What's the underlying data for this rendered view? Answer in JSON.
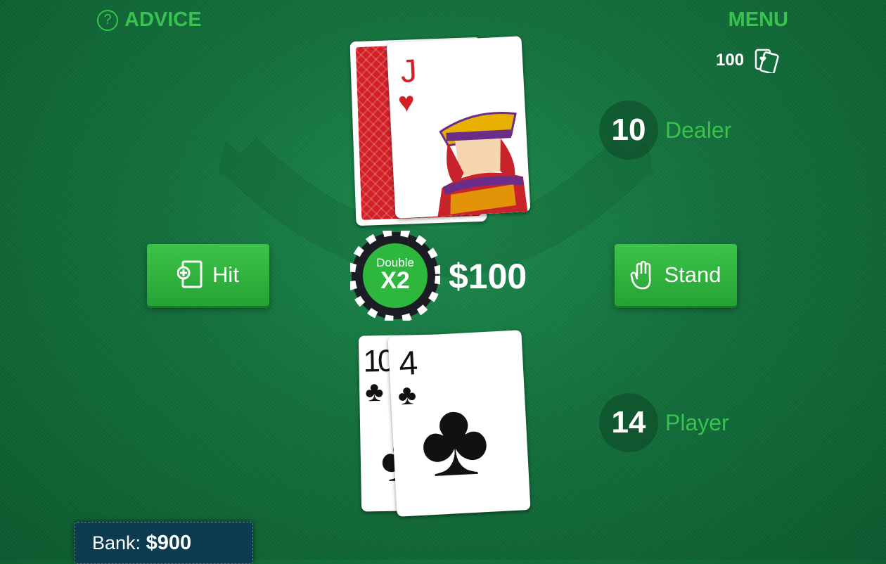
{
  "header": {
    "advice_label": "ADVICE",
    "advice_icon": "?",
    "menu_label": "MENU",
    "deck_count": "100"
  },
  "dealer": {
    "score": "10",
    "label": "Dealer",
    "cards": [
      {
        "rank": "J",
        "suit": "♥",
        "face_down": false
      },
      {
        "face_down": true
      }
    ]
  },
  "player": {
    "score": "14",
    "label": "Player",
    "cards": [
      {
        "rank": "10",
        "suit": "♣"
      },
      {
        "rank": "4",
        "suit": "♣"
      }
    ]
  },
  "actions": {
    "hit_label": "Hit",
    "stand_label": "Stand"
  },
  "chip": {
    "line1": "Double",
    "line2": "X2"
  },
  "bet": "$100",
  "bank": {
    "label": "Bank:",
    "value": "$900"
  },
  "colors": {
    "accent": "#39c24e",
    "felt": "#13703c",
    "button": "#2fb23e",
    "bank_bg": "#0d3b4f",
    "card_back": "#d32027"
  }
}
